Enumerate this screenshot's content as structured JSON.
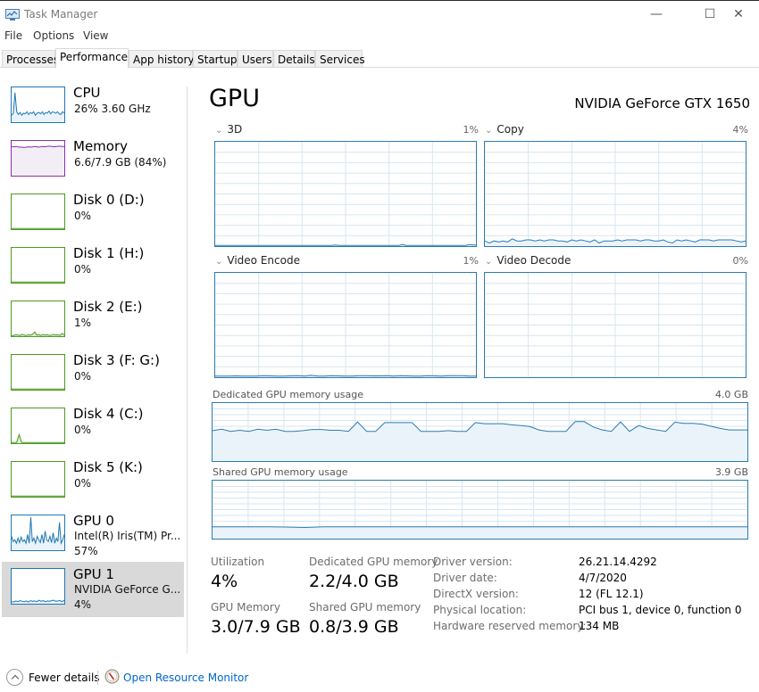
{
  "window": {
    "title": "Task Manager",
    "controls": {
      "minimize": "—",
      "maximize": "☐",
      "close": "✕"
    }
  },
  "menu": [
    "File",
    "Options",
    "View"
  ],
  "tabs": [
    {
      "label": "Processes",
      "active": false
    },
    {
      "label": "Performance",
      "active": true
    },
    {
      "label": "App history",
      "active": false
    },
    {
      "label": "Startup",
      "active": false
    },
    {
      "label": "Users",
      "active": false
    },
    {
      "label": "Details",
      "active": false
    },
    {
      "label": "Services",
      "active": false
    }
  ],
  "sidebar": {
    "items": [
      {
        "name": "CPU",
        "sub1": "26% 3.60 GHz",
        "sub2": "",
        "color": "#1e78b4",
        "fill": "#eaf3fa",
        "active": false,
        "kind": "cpu"
      },
      {
        "name": "Memory",
        "sub1": "6.6/7.9 GB (84%)",
        "sub2": "",
        "color": "#8b2da8",
        "fill": "#f3eef5",
        "active": false,
        "kind": "memory"
      },
      {
        "name": "Disk 0 (D:)",
        "sub1": "0%",
        "sub2": "",
        "color": "#4d9a20",
        "fill": "#ffffff",
        "active": false,
        "kind": "disk-flat"
      },
      {
        "name": "Disk 1 (H:)",
        "sub1": "0%",
        "sub2": "",
        "color": "#4d9a20",
        "fill": "#ffffff",
        "active": false,
        "kind": "disk-flat"
      },
      {
        "name": "Disk 2 (E:)",
        "sub1": "1%",
        "sub2": "",
        "color": "#4d9a20",
        "fill": "#ffffff",
        "active": false,
        "kind": "disk-low"
      },
      {
        "name": "Disk 3 (F: G:)",
        "sub1": "0%",
        "sub2": "",
        "color": "#4d9a20",
        "fill": "#ffffff",
        "active": false,
        "kind": "disk-flat"
      },
      {
        "name": "Disk 4 (C:)",
        "sub1": "0%",
        "sub2": "",
        "color": "#4d9a20",
        "fill": "#ffffff",
        "active": false,
        "kind": "disk-spike"
      },
      {
        "name": "Disk 5 (K:)",
        "sub1": "0%",
        "sub2": "",
        "color": "#4d9a20",
        "fill": "#ffffff",
        "active": false,
        "kind": "disk-flat"
      },
      {
        "name": "GPU 0",
        "sub1": "Intel(R) Iris(TM) Pr...",
        "sub2": "57%",
        "color": "#1e78b4",
        "fill": "#eaf3fa",
        "active": false,
        "kind": "gpu0"
      },
      {
        "name": "GPU 1",
        "sub1": "NVIDIA GeForce G...",
        "sub2": "4%",
        "color": "#1e78b4",
        "fill": "#eaf3fa",
        "active": true,
        "kind": "gpu1"
      }
    ]
  },
  "main": {
    "title": "GPU",
    "device": "NVIDIA GeForce GTX 1650",
    "engines": [
      {
        "label": "3D",
        "percent": "1%",
        "series": [
          0,
          0,
          0,
          0,
          0,
          0,
          0,
          0,
          0,
          0,
          0,
          0,
          0,
          0,
          0,
          0,
          0,
          0,
          0,
          0,
          0,
          0,
          0,
          0,
          0,
          0,
          0,
          0,
          0,
          0,
          0,
          0,
          0,
          0,
          0,
          0,
          1,
          0,
          0,
          0,
          0,
          0,
          0,
          0,
          0,
          0,
          0,
          0,
          0,
          0,
          0,
          0,
          0,
          0,
          0,
          0,
          1.5,
          0.5,
          0.5,
          0,
          0,
          0,
          0,
          0,
          0,
          0,
          0,
          0,
          0,
          0,
          0,
          0,
          0,
          0,
          0,
          0,
          1.5,
          1,
          1
        ]
      },
      {
        "label": "Copy",
        "percent": "4%",
        "series": [
          5,
          3,
          5,
          4,
          5,
          4,
          7,
          5,
          5,
          6,
          6,
          5,
          6,
          5,
          6,
          6,
          5,
          5,
          4,
          6,
          5,
          6,
          5,
          4,
          6,
          3,
          5,
          5,
          5,
          6,
          5,
          6,
          6,
          6,
          5,
          6,
          6,
          5,
          5,
          6,
          4,
          3,
          6,
          5,
          6,
          5,
          4,
          6,
          6,
          6,
          5,
          6,
          6,
          6,
          6,
          5,
          4,
          5
        ]
      },
      {
        "label": "Video Encode",
        "percent": "1%",
        "series": [
          1,
          1,
          1,
          1.3,
          1,
          1,
          1,
          1.5,
          1.3,
          1,
          1,
          1.3,
          1.5,
          1,
          1.8,
          1,
          1,
          1.5,
          1.3,
          1,
          1,
          1.5,
          1.5,
          1.3,
          1.3,
          1.5,
          1,
          1.5,
          1.3,
          1,
          1,
          1.5,
          1.3,
          1,
          1.5,
          1.5,
          1.5,
          1,
          1
        ]
      },
      {
        "label": "Video Decode",
        "percent": "0%",
        "series": []
      }
    ],
    "dedicated_memory_graph": {
      "label": "Dedicated GPU memory usage",
      "max": "4.0 GB",
      "series": [
        2.1,
        2.2,
        2.05,
        2.12,
        2.05,
        2.2,
        2.12,
        2.2,
        2.05,
        2.05,
        2.1,
        2.18,
        2.18,
        2.12,
        2.12,
        2.05,
        2.7,
        2.05,
        2.05,
        2.65,
        2.65,
        2.65,
        2.65,
        2.05,
        2.05,
        2.05,
        2.1,
        2.05,
        2.05,
        2.65,
        2.58,
        2.58,
        2.58,
        2.5,
        2.45,
        2.38,
        2.15,
        2.05,
        2.05,
        2.05,
        2.72,
        2.72,
        2.35,
        2.15,
        2.05,
        2.7,
        2.05,
        2.45,
        2.25,
        2.15,
        2.05,
        2.68,
        2.6,
        2.6,
        2.55,
        2.4,
        2.25,
        2.15,
        2.15,
        2.15
      ]
    },
    "shared_memory_graph": {
      "label": "Shared GPU memory usage",
      "max": "3.9 GB",
      "series": [
        0.8,
        0.8,
        0.8,
        0.8,
        0.78,
        0.75,
        0.8,
        0.8,
        0.8,
        0.8,
        0.8,
        0.8,
        0.8,
        0.8,
        0.8,
        0.8,
        0.8,
        0.8,
        0.8,
        0.8,
        0.8,
        0.8,
        0.8,
        0.8,
        0.8,
        0.8,
        0.8,
        0.8,
        0.8,
        0.8
      ]
    },
    "stats": {
      "utilization_label": "Utilization",
      "utilization": "4%",
      "dedicated_label": "Dedicated GPU memory",
      "dedicated": "2.2/4.0 GB",
      "gpu_memory_label": "GPU Memory",
      "gpu_memory": "3.0/7.9 GB",
      "shared_label": "Shared GPU memory",
      "shared": "0.8/3.9 GB"
    },
    "info": [
      {
        "key": "Driver version:",
        "value": "26.21.14.4292"
      },
      {
        "key": "Driver date:",
        "value": "4/7/2020"
      },
      {
        "key": "DirectX version:",
        "value": "12 (FL 12.1)"
      },
      {
        "key": "Physical location:",
        "value": "PCI bus 1, device 0, function 0"
      },
      {
        "key": "Hardware reserved memory:",
        "value": "134 MB"
      }
    ]
  },
  "footer": {
    "fewer_details": "Fewer details",
    "resource_monitor": "Open Resource Monitor"
  },
  "colors": {
    "gpu_line": "#2c7bb0",
    "gpu_fill": "#eaf3fa",
    "grid": "#d7e6f0",
    "link": "#0066cc"
  }
}
